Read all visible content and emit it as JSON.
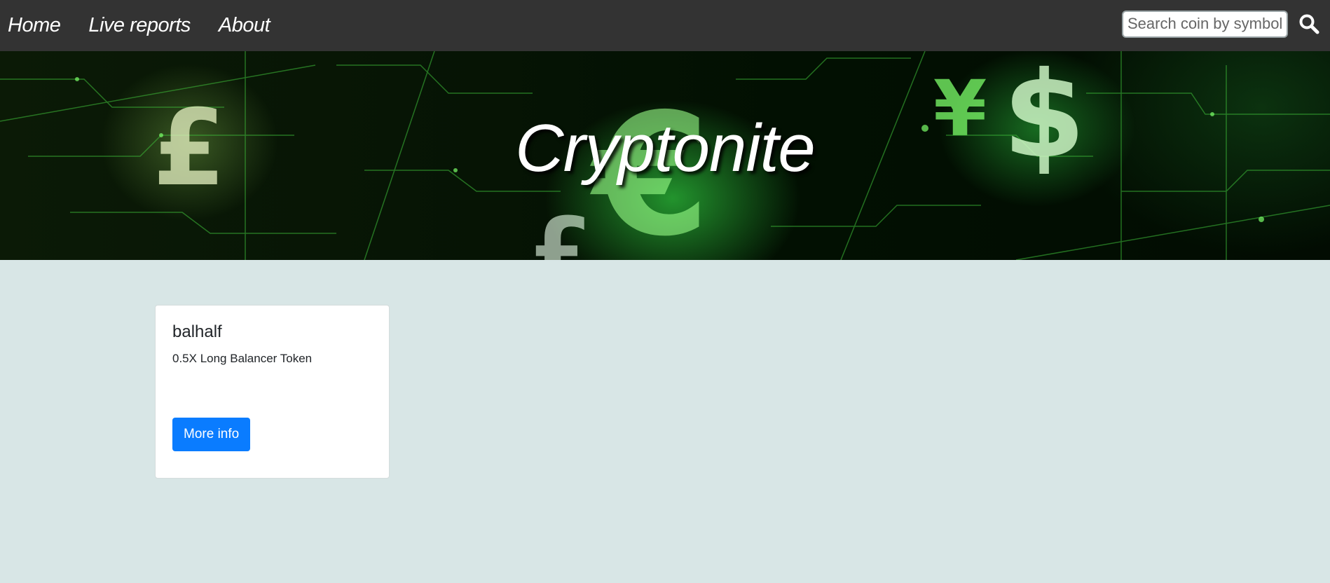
{
  "navbar": {
    "links": [
      "Home",
      "Live reports",
      "About"
    ],
    "search": {
      "placeholder": "Search coin by symbol..",
      "value": ""
    },
    "search_icon": "search-icon"
  },
  "banner": {
    "title": "Cryptonite"
  },
  "coins": [
    {
      "symbol": "balhalf",
      "name": "0.5X Long Balancer Token",
      "button_label": "More info"
    }
  ],
  "colors": {
    "navbar": "#333333",
    "page_background": "#d8e6e6",
    "button": "#0a7cff"
  }
}
